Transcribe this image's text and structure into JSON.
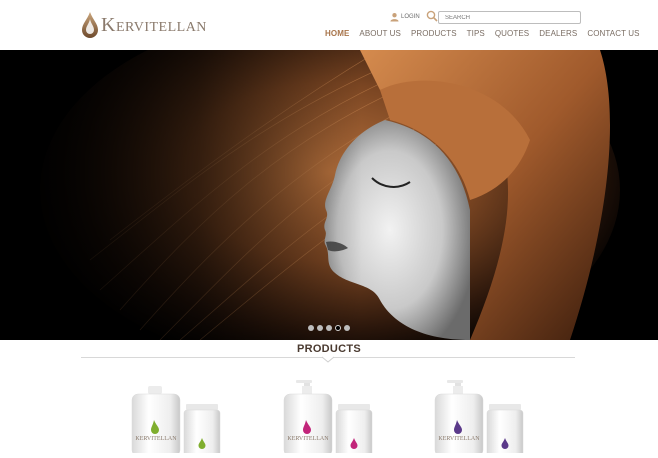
{
  "header": {
    "logo_text": "Kervitellan",
    "login_label": "LOGIN",
    "search_placeholder": "SEARCH",
    "brand_color": "#8a7a6c",
    "accent_color": "#a8744a"
  },
  "nav": {
    "items": [
      "HOME",
      "ABOUT US",
      "PRODUCTS",
      "TIPS",
      "QUOTES",
      "DEALERS",
      "CONTACT US"
    ],
    "active_index": 0
  },
  "hero": {
    "slide_count": 5,
    "active_slide": 3
  },
  "products": {
    "title": "PRODUCTS",
    "items": [
      {
        "label": "KERVITELLAN",
        "drop_color": "#7fae2e"
      },
      {
        "label": "KERVITELLAN",
        "drop_color": "#c2257a"
      },
      {
        "label": "KERVITELLAN",
        "drop_color": "#5b3a8a"
      }
    ]
  },
  "icons": {
    "login": "user-icon",
    "search": "search-icon",
    "logo": "drop-logo-icon"
  }
}
